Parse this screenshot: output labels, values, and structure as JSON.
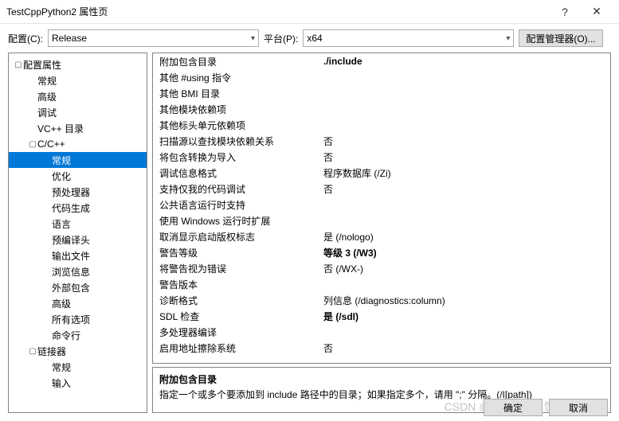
{
  "window": {
    "title": "TestCppPython2 属性页",
    "help": "?",
    "close": "✕"
  },
  "toolbar": {
    "config_label": "配置(C):",
    "config_value": "Release",
    "platform_label": "平台(P):",
    "platform_value": "x64",
    "config_mgr_label": "配置管理器(O)..."
  },
  "tree": [
    {
      "label": "配置属性",
      "depth": 0,
      "exp": "▢"
    },
    {
      "label": "常规",
      "depth": 1,
      "exp": ""
    },
    {
      "label": "高级",
      "depth": 1,
      "exp": ""
    },
    {
      "label": "调试",
      "depth": 1,
      "exp": ""
    },
    {
      "label": "VC++ 目录",
      "depth": 1,
      "exp": ""
    },
    {
      "label": "C/C++",
      "depth": 1,
      "exp": "▢"
    },
    {
      "label": "常规",
      "depth": 2,
      "exp": "",
      "selected": true
    },
    {
      "label": "优化",
      "depth": 2,
      "exp": ""
    },
    {
      "label": "预处理器",
      "depth": 2,
      "exp": ""
    },
    {
      "label": "代码生成",
      "depth": 2,
      "exp": ""
    },
    {
      "label": "语言",
      "depth": 2,
      "exp": ""
    },
    {
      "label": "预编译头",
      "depth": 2,
      "exp": ""
    },
    {
      "label": "输出文件",
      "depth": 2,
      "exp": ""
    },
    {
      "label": "浏览信息",
      "depth": 2,
      "exp": ""
    },
    {
      "label": "外部包含",
      "depth": 2,
      "exp": ""
    },
    {
      "label": "高级",
      "depth": 2,
      "exp": ""
    },
    {
      "label": "所有选项",
      "depth": 2,
      "exp": ""
    },
    {
      "label": "命令行",
      "depth": 2,
      "exp": ""
    },
    {
      "label": "链接器",
      "depth": 1,
      "exp": "▢"
    },
    {
      "label": "常规",
      "depth": 2,
      "exp": ""
    },
    {
      "label": "输入",
      "depth": 2,
      "exp": ""
    }
  ],
  "grid": [
    {
      "label": "附加包含目录",
      "value": "./include",
      "bold": true
    },
    {
      "label": "其他 #using 指令",
      "value": ""
    },
    {
      "label": "其他 BMI 目录",
      "value": ""
    },
    {
      "label": "其他模块依赖项",
      "value": ""
    },
    {
      "label": "其他标头单元依赖项",
      "value": ""
    },
    {
      "label": "扫描源以查找模块依赖关系",
      "value": "否"
    },
    {
      "label": "将包含转换为导入",
      "value": "否"
    },
    {
      "label": "调试信息格式",
      "value": "程序数据库 (/Zi)"
    },
    {
      "label": "支持仅我的代码调试",
      "value": "否"
    },
    {
      "label": "公共语言运行时支持",
      "value": ""
    },
    {
      "label": "使用 Windows 运行时扩展",
      "value": ""
    },
    {
      "label": "取消显示启动版权标志",
      "value": "是 (/nologo)"
    },
    {
      "label": "警告等级",
      "value": "等级 3 (/W3)",
      "bold": true
    },
    {
      "label": "将警告视为错误",
      "value": "否 (/WX-)"
    },
    {
      "label": "警告版本",
      "value": ""
    },
    {
      "label": "诊断格式",
      "value": "列信息 (/diagnostics:column)"
    },
    {
      "label": "SDL 检查",
      "value": "是 (/sdl)",
      "bold": true
    },
    {
      "label": "多处理器编译",
      "value": ""
    },
    {
      "label": "启用地址擦除系统",
      "value": "否"
    }
  ],
  "desc": {
    "title": "附加包含目录",
    "text": "指定一个或多个要添加到 include 路径中的目录；如果指定多个，请用 \";\" 分隔。(/I[path])"
  },
  "footer": {
    "ok": "确定",
    "cancel": "取消"
  },
  "watermark": "CSDN @moonpie月饼"
}
